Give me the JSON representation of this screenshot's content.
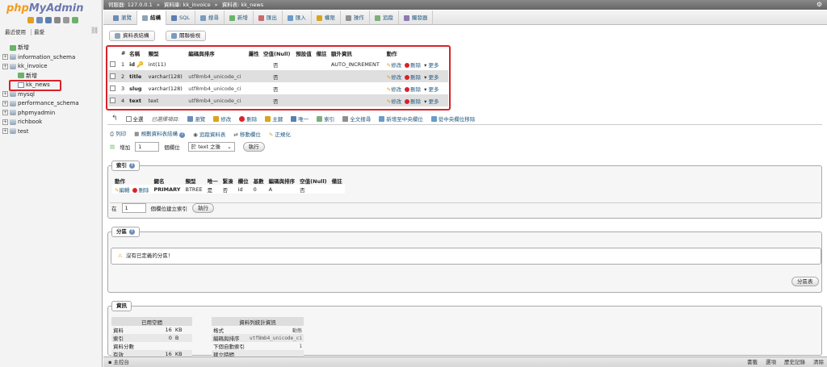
{
  "logo": {
    "php": "php",
    "my": "MyAdmin"
  },
  "left": {
    "recent": "最近使用",
    "favorites": "最愛",
    "tree": [
      {
        "label": "新增",
        "level": 0,
        "type": "new"
      },
      {
        "label": "information_schema",
        "level": 0,
        "type": "db"
      },
      {
        "label": "kk_invoice",
        "level": 0,
        "type": "db"
      },
      {
        "label": "新增",
        "level": 1,
        "type": "new"
      },
      {
        "label": "kk_news",
        "level": 1,
        "type": "table"
      },
      {
        "label": "mysql",
        "level": 0,
        "type": "db"
      },
      {
        "label": "performance_schema",
        "level": 0,
        "type": "db"
      },
      {
        "label": "phpmyadmin",
        "level": 0,
        "type": "db"
      },
      {
        "label": "richbook",
        "level": 0,
        "type": "db"
      },
      {
        "label": "test",
        "level": 0,
        "type": "db"
      }
    ]
  },
  "topbar": {
    "server": "伺服器: 127.0.0.1",
    "sep1": "»",
    "database": "資料庫: kk_invoice",
    "sep2": "»",
    "table": "資料表: kk_news"
  },
  "tabs": [
    {
      "label": "瀏覽",
      "color": "#6c8bb8"
    },
    {
      "label": "結構",
      "color": "#8fa3b5",
      "active": true
    },
    {
      "label": "SQL",
      "color": "#5a7fb0"
    },
    {
      "label": "搜尋",
      "color": "#7a9abf"
    },
    {
      "label": "新增",
      "color": "#6bb36b"
    },
    {
      "label": "匯出",
      "color": "#c86b6b"
    },
    {
      "label": "匯入",
      "color": "#6b9bc8"
    },
    {
      "label": "權限",
      "color": "#d9a51c"
    },
    {
      "label": "操作",
      "color": "#8f8f8f"
    },
    {
      "label": "追蹤",
      "color": "#7ab07a"
    },
    {
      "label": "觸發器",
      "color": "#8f7ab0"
    }
  ],
  "subtabs": {
    "structure": "資料表結構",
    "relation": "關聯檢視"
  },
  "structure": {
    "headers": [
      "#",
      "名稱",
      "類型",
      "編碼與排序",
      "屬性",
      "空值(Null)",
      "預設值",
      "備註",
      "額外資訊",
      "動作"
    ],
    "rows": [
      {
        "num": "1",
        "name": "id",
        "type": "int(11)",
        "collation": "",
        "null": "否",
        "default": "",
        "extra": "AUTO_INCREMENT",
        "pk": true
      },
      {
        "num": "2",
        "name": "title",
        "type": "varchar(128)",
        "collation": "utf8mb4_unicode_ci",
        "null": "否",
        "default": "",
        "extra": ""
      },
      {
        "num": "3",
        "name": "slug",
        "type": "varchar(128)",
        "collation": "utf8mb4_unicode_ci",
        "null": "否",
        "default": "",
        "extra": ""
      },
      {
        "num": "4",
        "name": "text",
        "type": "text",
        "collation": "utf8mb4_unicode_ci",
        "null": "否",
        "default": "",
        "extra": ""
      }
    ],
    "action_edit": "修改",
    "action_delete": "刪除",
    "action_more": "更多"
  },
  "bulk": {
    "check_all": "全選",
    "selected": "已選擇項目:",
    "browse": "瀏覽",
    "edit": "修改",
    "delete": "刪除",
    "primary": "主鍵",
    "unique": "唯一",
    "index": "索引",
    "fulltext": "全文搜尋",
    "add_central": "新增至中央欄位",
    "remove_central": "從中央欄位移除"
  },
  "tools": {
    "print": "列印",
    "propose": "規劃資料表結構",
    "track": "追蹤資料表",
    "move": "移動欄位",
    "normalize": "正規化"
  },
  "add_row": {
    "label": "增加",
    "count": "1",
    "unit": "個欄位",
    "position": "於 text 之後",
    "go": "執行"
  },
  "indexes": {
    "legend": "索引",
    "headers": [
      "動作",
      "鍵名",
      "類型",
      "唯一",
      "緊湊",
      "欄位",
      "基數",
      "編碼與排序",
      "空值(Null)",
      "備註"
    ],
    "row": {
      "edit": "編輯",
      "delete": "刪除",
      "keyname": "PRIMARY",
      "type": "BTREE",
      "unique": "是",
      "packed": "否",
      "column": "id",
      "cardinality": "0",
      "collation": "A",
      "null": "否",
      "comment": ""
    },
    "create_prefix": "在",
    "create_count": "1",
    "create_suffix": "個欄位建立索引",
    "go": "執行"
  },
  "partitions": {
    "legend": "分區",
    "warning": "沒有已定義的分區！",
    "button": "分區表"
  },
  "info": {
    "legend": "資訊",
    "space_title": "已用空間",
    "space_rows": [
      {
        "k": "資料",
        "v": "16",
        "u": "KB"
      },
      {
        "k": "索引",
        "v": "0",
        "u": "B"
      },
      {
        "k": "資料分數",
        "v": "",
        "u": ""
      },
      {
        "k": "有效",
        "v": "16",
        "u": "KB"
      }
    ],
    "stats_title": "資料列統計資訊",
    "stats_rows": [
      {
        "k": "格式",
        "v": "動態"
      },
      {
        "k": "編碼與排序",
        "v": "utf8mb4_unicode_ci"
      },
      {
        "k": "下個自動索引",
        "v": "1"
      },
      {
        "k": "建立時間",
        "v": ""
      }
    ]
  },
  "bottombar": {
    "console": "主控台",
    "links": [
      "書籤",
      "選項",
      "歷史記錄",
      "清除"
    ]
  }
}
